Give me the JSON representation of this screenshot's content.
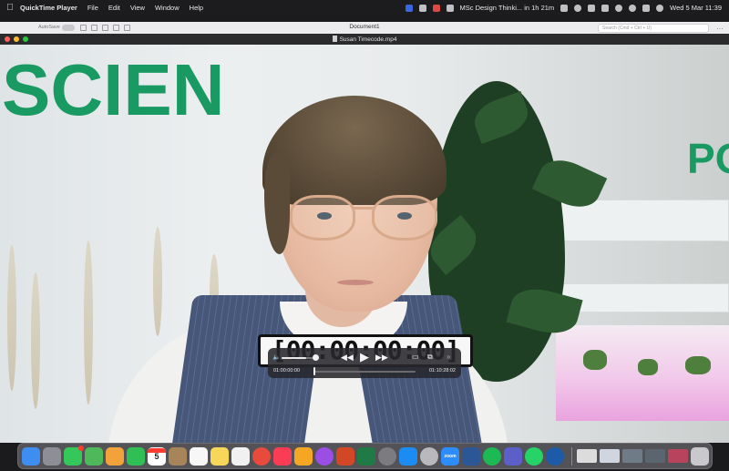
{
  "menubar": {
    "app_name": "QuickTime Player",
    "menus": [
      "File",
      "Edit",
      "View",
      "Window",
      "Help"
    ],
    "calendar_event": "MSc Design Thinki... in 1h 21m",
    "datetime": "Wed 5 Mar  11:39"
  },
  "doc_window": {
    "autosave_label": "AutoSave",
    "title": "Document1",
    "search_placeholder": "Search (Cmd + Ctrl + U)",
    "more": "…"
  },
  "qt_window": {
    "title": "Susan Timecode.mp4"
  },
  "video": {
    "banner_left": "SCIEN",
    "banner_right": "PO",
    "timecode": "[00:00:00:00]"
  },
  "controls": {
    "volume_level": 0.8,
    "rewind_icon": "◀◀",
    "play_icon": "▶",
    "forward_icon": "▶▶",
    "current_time": "01:00:00:00",
    "remaining_time": "01:10:28:02",
    "progress": 0.0,
    "airplay_icon": "▭",
    "pip_icon": "⧉",
    "more_icon": "»"
  },
  "dock": {
    "calendar_day": "5",
    "zoom_label": "zoom",
    "apps": [
      {
        "name": "finder",
        "color": "#3d8ef0"
      },
      {
        "name": "launchpad",
        "color": "#8e8e96"
      },
      {
        "name": "messages",
        "color": "#34c759"
      },
      {
        "name": "maps",
        "color": "#4fb85a"
      },
      {
        "name": "photos",
        "color": "#f2a23a"
      },
      {
        "name": "facetime",
        "color": "#2fbf55"
      },
      {
        "name": "calendar",
        "color": "#ffffff"
      },
      {
        "name": "contacts",
        "color": "#a8845a"
      },
      {
        "name": "reminders",
        "color": "#f7f7f7"
      },
      {
        "name": "notes",
        "color": "#f6d75a"
      },
      {
        "name": "freeform",
        "color": "#f1f1f1"
      },
      {
        "name": "chrome",
        "color": "#e84a3c"
      },
      {
        "name": "music",
        "color": "#fa3c55"
      },
      {
        "name": "pages",
        "color": "#f5a623"
      },
      {
        "name": "podcasts",
        "color": "#9a4ee3"
      },
      {
        "name": "powerpoint",
        "color": "#d24726"
      },
      {
        "name": "excel",
        "color": "#1f7a45"
      },
      {
        "name": "settings",
        "color": "#7b7b80"
      },
      {
        "name": "app-store",
        "color": "#1d8cf2"
      },
      {
        "name": "whatsapp-alt",
        "color": "#b9b9bd"
      },
      {
        "name": "zoom",
        "color": "#2d8cff"
      },
      {
        "name": "word",
        "color": "#2b5797"
      },
      {
        "name": "spotify",
        "color": "#1db954"
      },
      {
        "name": "teams",
        "color": "#5b5fc7"
      },
      {
        "name": "whatsapp",
        "color": "#25d366"
      },
      {
        "name": "quicktime",
        "color": "#1d5aa8"
      }
    ]
  }
}
